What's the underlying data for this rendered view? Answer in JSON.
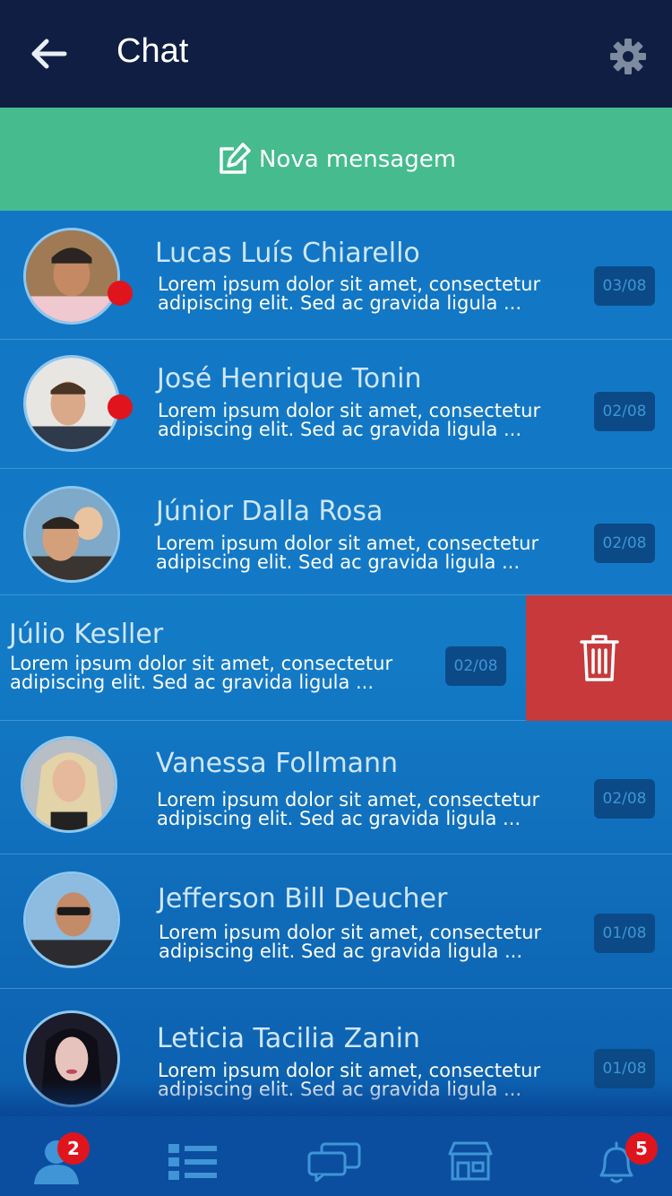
{
  "header": {
    "title": "Chat",
    "back_icon": "arrow-left-icon",
    "settings_icon": "gear-icon"
  },
  "new_message": {
    "label": "Nova mensagem",
    "icon": "edit-icon"
  },
  "conversations": [
    {
      "name": "Lucas Luís Chiarello",
      "preview_line1": "Lorem ipsum dolor sit amet, consectetur",
      "preview_line2": "adipiscing elit. Sed ac gravida ligula ...",
      "date": "03/08",
      "unread": true
    },
    {
      "name": "José Henrique Tonin",
      "preview_line1": "Lorem ipsum dolor sit amet, consectetur",
      "preview_line2": "adipiscing elit. Sed ac gravida ligula ...",
      "date": "02/08",
      "unread": true
    },
    {
      "name": "Júnior Dalla Rosa",
      "preview_line1": "Lorem ipsum dolor sit amet, consectetur",
      "preview_line2": "adipiscing elit. Sed ac gravida ligula ...",
      "date": "02/08",
      "unread": false
    },
    {
      "name": "Júlio  Kesller",
      "preview_line1": "Lorem ipsum dolor sit amet, consectetur",
      "preview_line2": "adipiscing elit. Sed ac gravida ligula ...",
      "date": "02/08",
      "unread": false,
      "swiped": true
    },
    {
      "name": "Vanessa Follmann",
      "preview_line1": "Lorem ipsum dolor sit amet, consectetur",
      "preview_line2": "adipiscing elit. Sed ac gravida ligula ...",
      "date": "02/08",
      "unread": false
    },
    {
      "name": "Jefferson Bill Deucher",
      "preview_line1": "Lorem ipsum dolor sit amet, consectetur",
      "preview_line2": "adipiscing elit. Sed ac gravida ligula ...",
      "date": "01/08",
      "unread": false
    },
    {
      "name": "Leticia Tacilia Zanin",
      "preview_line1": "Lorem ipsum dolor sit amet, consectetur",
      "preview_line2": "adipiscing elit. Sed ac gravida ligula ...",
      "date": "01/08",
      "unread": false
    }
  ],
  "delete_action": {
    "icon": "trash-icon",
    "color": "#c7393b"
  },
  "bottom_nav": {
    "contacts": {
      "icon": "person-icon",
      "badge": "2"
    },
    "list": {
      "icon": "list-icon"
    },
    "chat": {
      "icon": "chat-bubbles-icon"
    },
    "store": {
      "icon": "store-icon"
    },
    "notifications": {
      "icon": "bell-icon",
      "badge": "5"
    }
  },
  "colors": {
    "header": "#0f1e42",
    "new_message": "#45bb8e",
    "list": "#1276c4",
    "nav": "#0b4ea0",
    "badge": "#e0141d"
  }
}
